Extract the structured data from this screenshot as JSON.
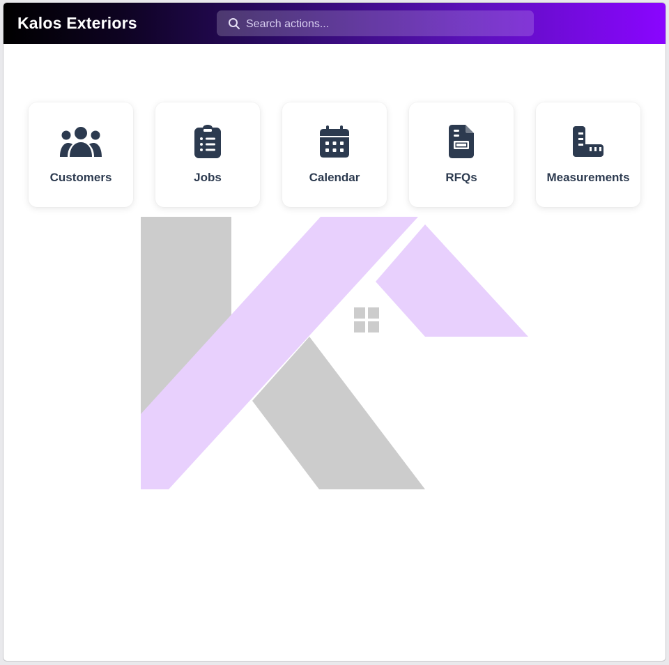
{
  "header": {
    "brand": "Kalos Exteriors",
    "search_placeholder": "Search actions..."
  },
  "colors": {
    "header_gradient_start": "#000000",
    "header_gradient_end": "#8a05ff",
    "tile_text": "#2c3a4f",
    "icon_color": "#2c3a4f",
    "logo_gray": "#cccccc",
    "logo_lavender": "#e8d0fd"
  },
  "tiles": [
    {
      "label": "Customers",
      "icon": "users-icon"
    },
    {
      "label": "Jobs",
      "icon": "clipboard-list-icon"
    },
    {
      "label": "Calendar",
      "icon": "calendar-icon"
    },
    {
      "label": "RFQs",
      "icon": "file-invoice-icon"
    },
    {
      "label": "Measurements",
      "icon": "ruler-icon"
    }
  ],
  "logo": {
    "icon": "kalos-k-house-logo"
  }
}
